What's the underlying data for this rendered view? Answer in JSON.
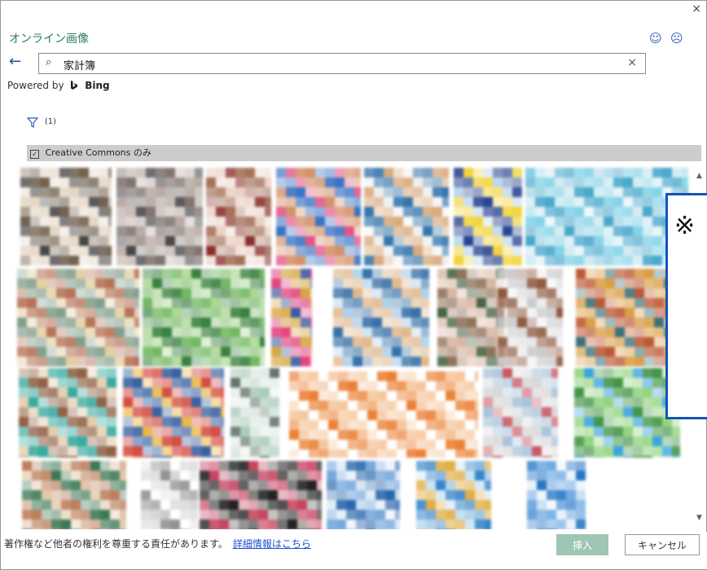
{
  "dialog": {
    "title": "オンライン画像",
    "close_glyph": "×",
    "smile_glyph": "☺",
    "frown_glyph": "☹"
  },
  "search": {
    "back_glyph": "←",
    "search_glyph": "⌕",
    "value": "家計簿",
    "clear_glyph": "×"
  },
  "powered": {
    "prefix": "Powered by",
    "brand": "Bing"
  },
  "filter": {
    "count": "(1)"
  },
  "license_filter": {
    "label": "Creative Commons のみ",
    "checked": true
  },
  "overlay": {
    "mark": "※"
  },
  "footer": {
    "notice": "著作権など他者の権利を尊重する責任があります。",
    "link": "詳細情報はこちら",
    "insert_label": "挿入",
    "cancel_label": "キャンセル"
  },
  "colors": {
    "accent": "#2b7a5c",
    "link": "#1a4fd0",
    "overlay_border": "#1553b8"
  },
  "results": [
    {
      "name": "result-image-1",
      "colors": [
        "#6a5a46",
        "#e4d5c2",
        "#3d3d3d"
      ]
    },
    {
      "name": "result-image-2",
      "colors": [
        "#7b6d66",
        "#b8a7a0",
        "#3e3d40"
      ]
    },
    {
      "name": "result-image-3",
      "colors": [
        "#a06a50",
        "#e9cfc1",
        "#842424"
      ]
    },
    {
      "name": "result-image-4",
      "colors": [
        "#d28c62",
        "#2f6bbf",
        "#e44a84"
      ]
    },
    {
      "name": "result-image-5",
      "colors": [
        "#2b6fa8",
        "#d6a676",
        "#eeeeee"
      ]
    },
    {
      "name": "result-image-6",
      "colors": [
        "#1f3b8c",
        "#f1d334",
        "#b9d6ef"
      ]
    },
    {
      "name": "result-image-7",
      "colors": [
        "#3fa3c8",
        "#7fd1e6",
        "#cfe9f2"
      ]
    },
    {
      "name": "result-image-8",
      "colors": [
        "#b26b4e",
        "#7c9a86",
        "#e3cf9c"
      ]
    },
    {
      "name": "result-image-9",
      "colors": [
        "#2f7a36",
        "#6db55a",
        "#a9d68d"
      ]
    },
    {
      "name": "result-image-10",
      "colors": [
        "#e23d7a",
        "#d4a23a",
        "#2f4f9f"
      ]
    },
    {
      "name": "result-image-11",
      "colors": [
        "#2c69a3",
        "#e0b589",
        "#a9d0ec"
      ]
    },
    {
      "name": "result-image-12",
      "colors": [
        "#8b6b52",
        "#d7b3a0",
        "#3b5d3a"
      ]
    },
    {
      "name": "result-image-13",
      "colors": [
        "#c9c9c9",
        "#8a5338",
        "#eeeeee"
      ]
    },
    {
      "name": "result-image-14",
      "colors": [
        "#b8502a",
        "#d99a3e",
        "#2d6b74"
      ]
    },
    {
      "name": "result-image-15",
      "colors": [
        "#2fa59b",
        "#8b5a3c",
        "#e4c9a8"
      ]
    },
    {
      "name": "result-image-16",
      "colors": [
        "#d2443a",
        "#2f5a9e",
        "#e9b53d"
      ]
    },
    {
      "name": "result-image-17",
      "colors": [
        "#a7c9b8",
        "#dfe9e3",
        "#5e6e66"
      ]
    },
    {
      "name": "result-image-18",
      "colors": [
        "#ea7a2a",
        "#f6c49a",
        "#ffffff"
      ]
    },
    {
      "name": "result-image-19",
      "colors": [
        "#d7d7d7",
        "#a7c1d9",
        "#c94e5a"
      ]
    },
    {
      "name": "result-image-20",
      "colors": [
        "#3a8f3e",
        "#8ed27a",
        "#2d9fe0"
      ]
    },
    {
      "name": "result-image-21",
      "colors": [
        "#b97955",
        "#33724c",
        "#e2c6a4"
      ]
    },
    {
      "name": "result-image-22",
      "colors": [
        "#dcdcdc",
        "#8c8c8c",
        "#ffffff"
      ]
    },
    {
      "name": "result-image-23",
      "colors": [
        "#161616",
        "#c43c59",
        "#5a5a5a"
      ]
    },
    {
      "name": "result-image-24",
      "colors": [
        "#1e5ea8",
        "#6ea3da",
        "#d7e6f4"
      ]
    },
    {
      "name": "result-image-25",
      "colors": [
        "#2d7fc7",
        "#e0a93a",
        "#bfe0f4"
      ]
    },
    {
      "name": "result-image-26",
      "colors": [
        "#1a70c4",
        "#6aa8e0",
        "#e8f1fa"
      ]
    }
  ]
}
